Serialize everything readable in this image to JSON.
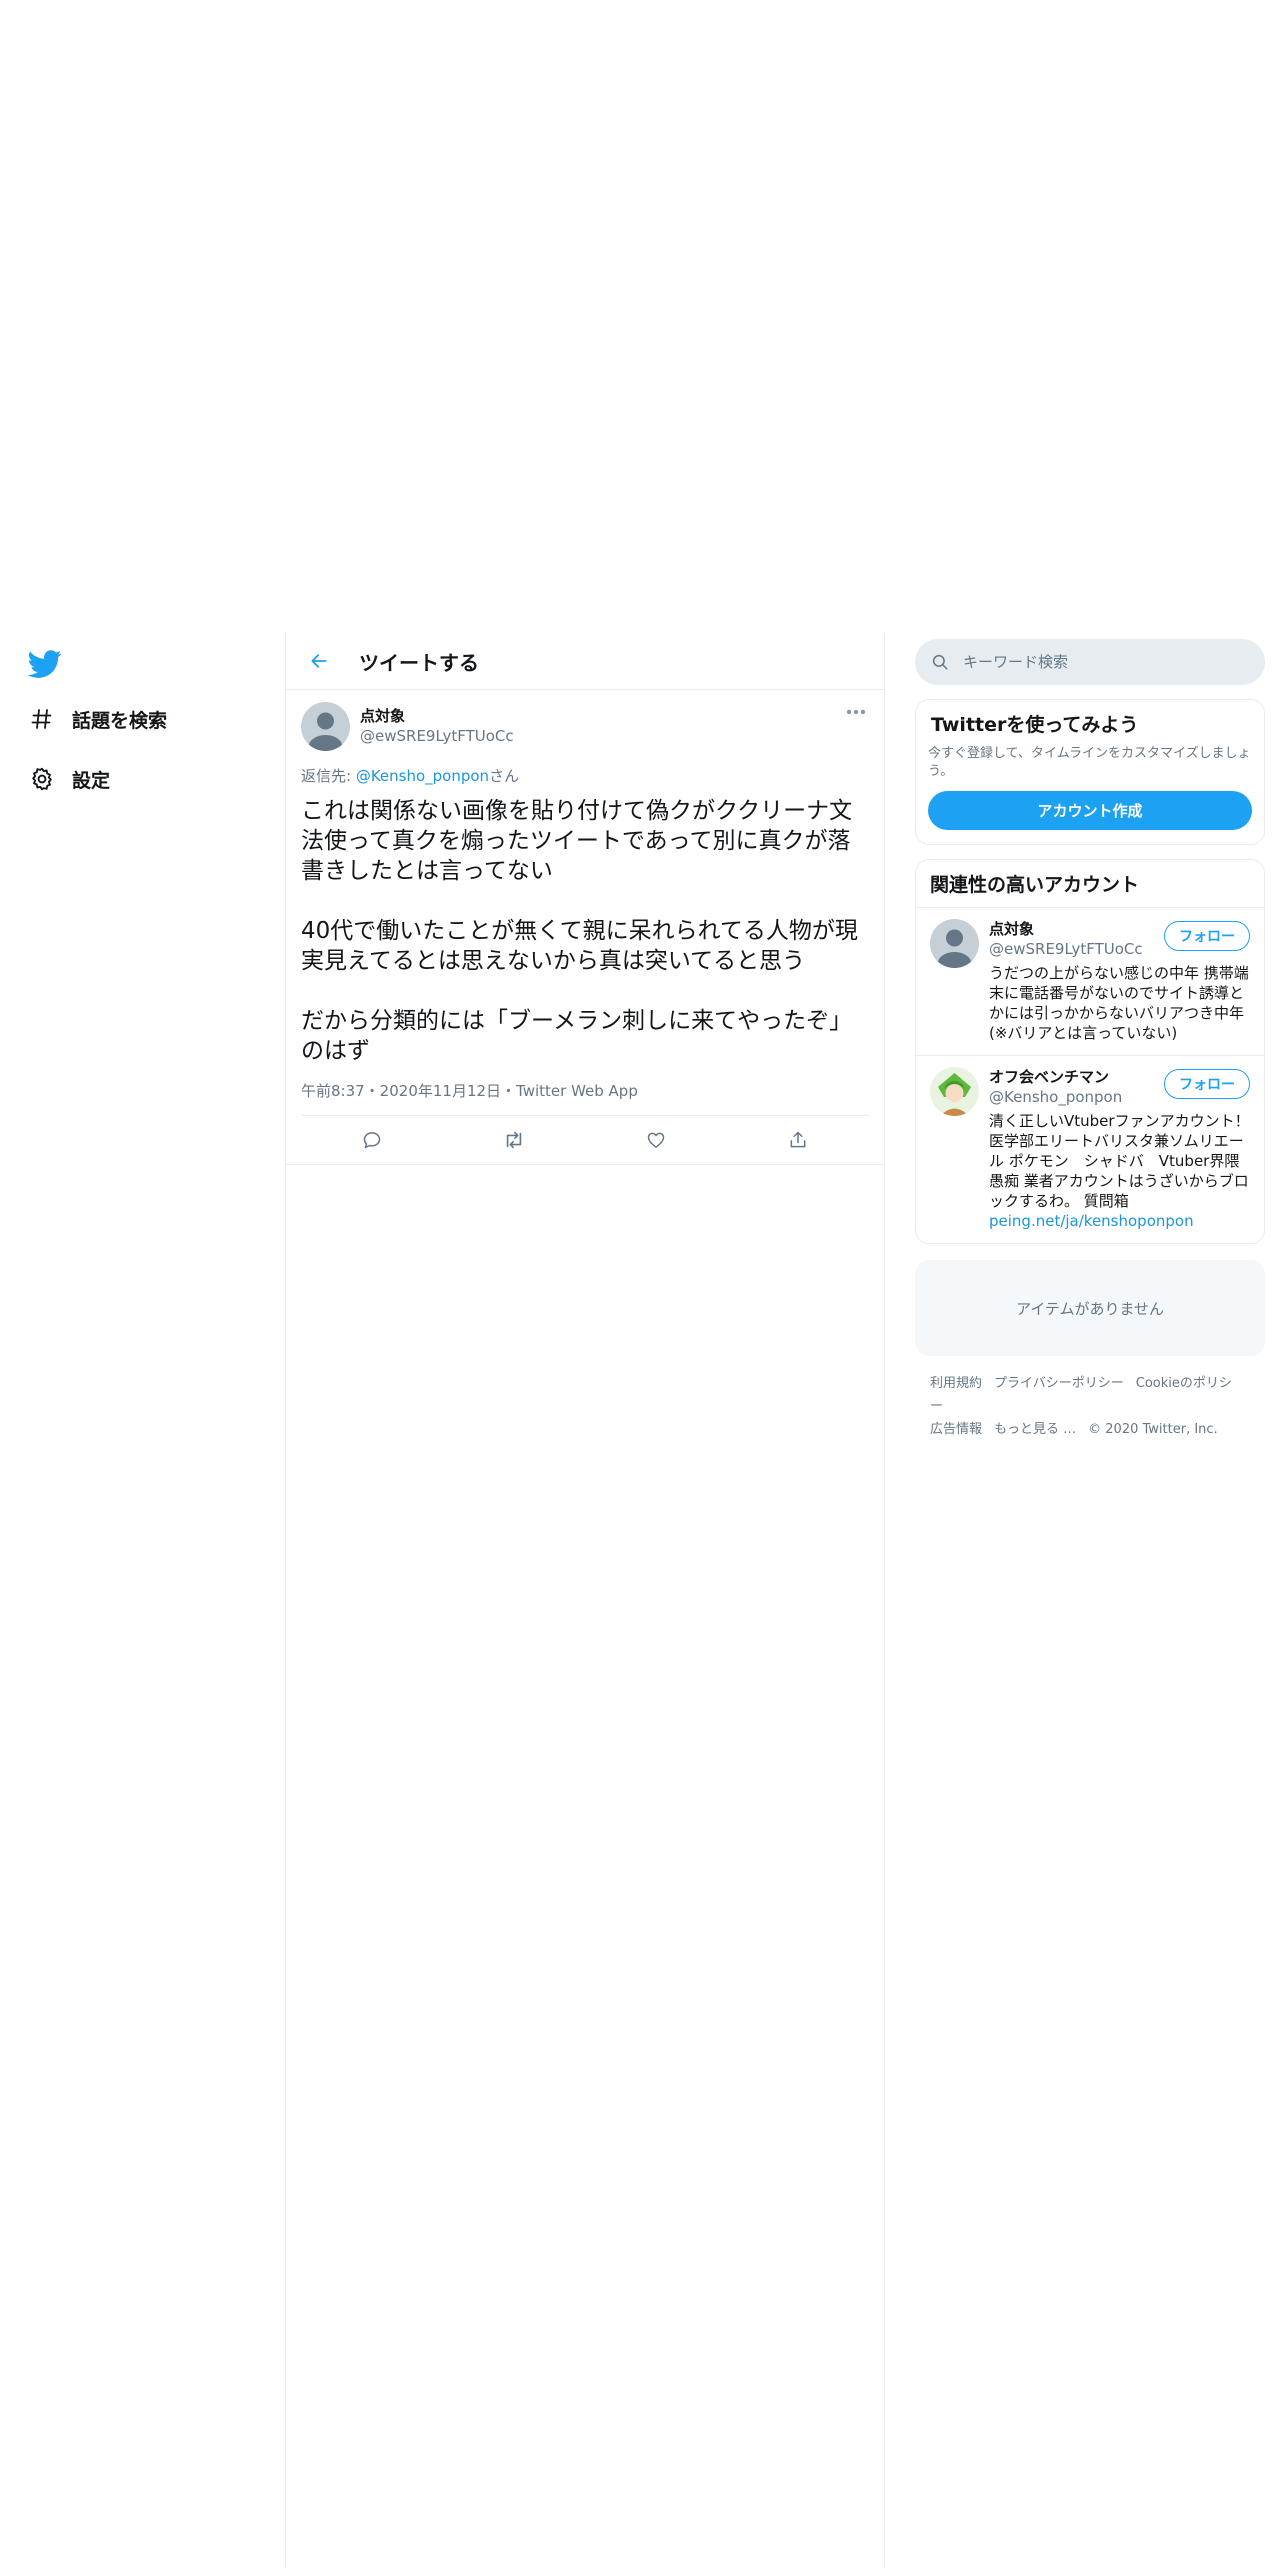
{
  "nav": {
    "items": [
      {
        "label": "話題を検索",
        "icon": "hashtag-icon"
      },
      {
        "label": "設定",
        "icon": "gear-icon"
      }
    ]
  },
  "header": {
    "title": "ツイートする"
  },
  "tweet": {
    "author_name": "点対象",
    "author_handle": "@ewSRE9LytFTUoCc",
    "reply_prefix": "返信先: ",
    "reply_handle": "@Kensho_ponpon",
    "reply_suffix": "さん",
    "text": "これは関係ない画像を貼り付けて偽クがククリーナ文法使って真クを煽ったツイートであって別に真クが落書きしたとは言ってない\n\n40代で働いたことが無くて親に呆れられてる人物が現実見えてるとは思えないから真は突いてると思う\n\nだから分類的には「ブーメラン刺しに来てやったぞ」のはず",
    "meta": "午前8:37・2020年11月12日・Twitter Web App"
  },
  "search": {
    "placeholder": "キーワード検索"
  },
  "signup": {
    "title": "Twitterを使ってみよう",
    "description": "今すぐ登録して、タイムラインをカスタマイズしましょう。",
    "button_label": "アカウント作成"
  },
  "related": {
    "title": "関連性の高いアカウント",
    "follow_label": "フォロー",
    "users": [
      {
        "name": "点対象",
        "handle": "@ewSRE9LytFTUoCc",
        "bio": "うだつの上がらない感じの中年 携帯端末に電話番号がないのでサイト誘導とかには引っかからないバリアつき中年(※バリアとは言っていない)"
      },
      {
        "name": "オフ会ベンチマン",
        "handle": "@Kensho_ponpon",
        "bio": "清く正しいVtuberファンアカウント！ 医学部エリートバリスタ兼ソムリエール ポケモン　シャドバ　Vtuber界隈 愚痴 業者アカウントはうざいからブロックするわ。 質問箱",
        "bio_link": "peing.net/ja/kenshoponpon"
      }
    ]
  },
  "empty_message": "アイテムがありません",
  "footer": {
    "links": [
      "利用規約",
      "プライバシーポリシー",
      "Cookieのポリシー",
      "広告情報",
      "もっと見る …"
    ],
    "copyright": "© 2020 Twitter, Inc."
  },
  "colors": {
    "accent": "#1da1f2",
    "link": "#1b95e0",
    "muted": "#657786",
    "border": "#e6ecf0"
  }
}
